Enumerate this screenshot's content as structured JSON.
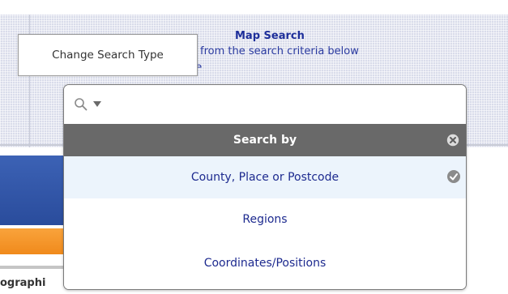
{
  "panel": {
    "title": "Map Search",
    "instruction": "from the search criteria below",
    "current_type": "County, Place or Postcode..."
  },
  "tooltip": {
    "text": "Change Search Type"
  },
  "search": {
    "value": "",
    "placeholder": "",
    "search_icon": "search-icon",
    "dropdown_icon": "caret-down-icon"
  },
  "dropdown": {
    "header": "Search by",
    "close_icon": "close-circle-icon",
    "options": [
      {
        "label": "County, Place or Postcode",
        "selected": true
      },
      {
        "label": "Regions",
        "selected": false
      },
      {
        "label": "Coordinates/Positions",
        "selected": false
      }
    ],
    "selected_icon": "check-circle-icon"
  },
  "background": {
    "left_label": "ographi"
  },
  "colors": {
    "header_bg": "#696969",
    "option_text": "#1d2a8f",
    "panel_title": "#1e2f9a",
    "orange_bar": "#f08a1c",
    "blue_block": "#2a4c9c"
  }
}
